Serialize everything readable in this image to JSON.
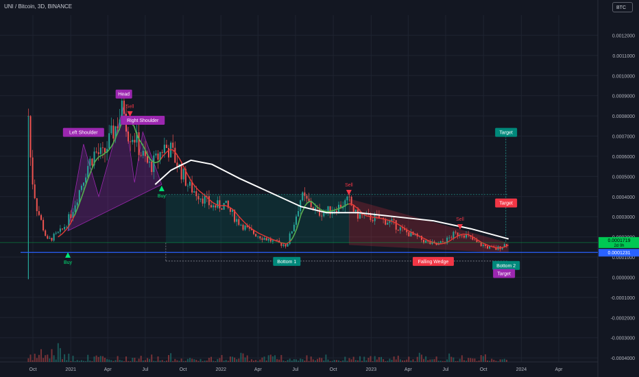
{
  "header": {
    "title": "UNI / Bitcoin, 3D, BINANCE",
    "currency_badge": "BTC"
  },
  "colors": {
    "background": "#131722",
    "grid": "#1f2431",
    "candle_up": "#26a69a",
    "candle_down": "#ef5350",
    "ma_white": "#ffffff",
    "support_line": "#2962ff",
    "last_price": "#00c853",
    "pattern_purple": "#9c27b0",
    "target_teal": "#00897b",
    "target_red": "#f23645"
  },
  "chart_data": {
    "type": "candlestick",
    "title": "UNI / Bitcoin, 3D, BINANCE",
    "y_axis": {
      "ticks": [
        "0.0012000",
        "0.0011000",
        "0.0010000",
        "0.0009000",
        "0.0008000",
        "0.0007000",
        "0.0006000",
        "0.0005000",
        "0.0004000",
        "0.0003000",
        "0.0002000",
        "0.0001000",
        "0.0000000",
        "-0.0001000",
        "-0.0002000",
        "-0.0003000",
        "-0.0004000"
      ],
      "ylim": [
        -0.00042,
        0.0013
      ]
    },
    "x_axis": {
      "ticks": [
        "Oct",
        "2021",
        "Apr",
        "Jul",
        "Oct",
        "2022",
        "Apr",
        "Jul",
        "Oct",
        "2023",
        "Apr",
        "Jul",
        "Oct",
        "2024",
        "Apr"
      ]
    },
    "price_path": [
      [
        "2020-09-20",
        0.0008
      ],
      [
        "2020-09-27",
        0.00052
      ],
      [
        "2020-10-10",
        0.00035
      ],
      [
        "2020-10-25",
        0.00025
      ],
      [
        "2020-11-05",
        0.00018
      ],
      [
        "2020-11-20",
        0.0002
      ],
      [
        "2020-12-10",
        0.00023
      ],
      [
        "2020-12-30",
        0.0003
      ],
      [
        "2021-01-20",
        0.00042
      ],
      [
        "2021-02-10",
        0.00055
      ],
      [
        "2021-03-01",
        0.00062
      ],
      [
        "2021-03-20",
        0.0006
      ],
      [
        "2021-04-10",
        0.0007
      ],
      [
        "2021-05-01",
        0.0008
      ],
      [
        "2021-05-10",
        0.00085
      ],
      [
        "2021-05-20",
        0.00072
      ],
      [
        "2021-06-05",
        0.0007
      ],
      [
        "2021-06-20",
        0.00062
      ],
      [
        "2021-07-10",
        0.00055
      ],
      [
        "2021-07-25",
        0.00057
      ],
      [
        "2021-08-15",
        0.00065
      ],
      [
        "2021-09-01",
        0.00063
      ],
      [
        "2021-09-20",
        0.00055
      ],
      [
        "2021-10-15",
        0.00045
      ],
      [
        "2021-11-15",
        0.0004
      ],
      [
        "2021-12-10",
        0.00035
      ],
      [
        "2022-01-10",
        0.00036
      ],
      [
        "2022-02-10",
        0.00028
      ],
      [
        "2022-03-10",
        0.00023
      ],
      [
        "2022-04-10",
        0.0002
      ],
      [
        "2022-05-15",
        0.00017
      ],
      [
        "2022-06-10",
        0.00016
      ],
      [
        "2022-06-25",
        0.00025
      ],
      [
        "2022-07-15",
        0.0004
      ],
      [
        "2022-08-01",
        0.00037
      ],
      [
        "2022-08-25",
        0.00032
      ],
      [
        "2022-09-20",
        0.00033
      ],
      [
        "2022-10-15",
        0.00035
      ],
      [
        "2022-11-08",
        0.00038
      ],
      [
        "2022-11-25",
        0.00031
      ],
      [
        "2022-12-20",
        0.0003
      ],
      [
        "2023-01-20",
        0.00029
      ],
      [
        "2023-02-20",
        0.00027
      ],
      [
        "2023-03-20",
        0.00023
      ],
      [
        "2023-04-20",
        0.0002
      ],
      [
        "2023-05-20",
        0.00017
      ],
      [
        "2023-06-10",
        0.00016
      ],
      [
        "2023-07-01",
        0.00018
      ],
      [
        "2023-07-20",
        0.00021
      ],
      [
        "2023-08-10",
        0.00022
      ],
      [
        "2023-08-25",
        0.0002
      ],
      [
        "2023-09-15",
        0.00017
      ],
      [
        "2023-10-10",
        0.00015
      ],
      [
        "2023-11-01",
        0.00014
      ],
      [
        "2023-11-20",
        0.00016
      ],
      [
        "2023-12-01",
        0.000172
      ]
    ],
    "last_price": {
      "value": 0.0001719,
      "label": "0.0001719",
      "countdown": "2d 0h"
    },
    "support_level": {
      "value": 0.0001231,
      "label": "0.0001231"
    },
    "resistance_level": 0.00041,
    "entry_level": 0.00017,
    "bottom_level": 8e-05,
    "target_levels": [
      0.00071,
      0.00037,
      0.00012
    ],
    "annotations": [
      {
        "text": "Head",
        "kind": "pattern",
        "date": "2021-05-10",
        "price": 0.00091
      },
      {
        "text": "Left Shoulder",
        "kind": "pattern",
        "date": "2021-02-01",
        "price": 0.00072
      },
      {
        "text": "Right Shoulder",
        "kind": "pattern",
        "date": "2021-06-25",
        "price": 0.00078
      },
      {
        "text": "Buy",
        "kind": "signal",
        "date": "2020-12-25",
        "price": 9e-05
      },
      {
        "text": "Buy",
        "kind": "signal",
        "date": "2021-08-10",
        "price": 0.00042
      },
      {
        "text": "Sell",
        "kind": "signal",
        "date": "2021-05-25",
        "price": 0.00083
      },
      {
        "text": "Sell",
        "kind": "signal",
        "date": "2022-11-08",
        "price": 0.00044
      },
      {
        "text": "Sell",
        "kind": "signal",
        "date": "2023-08-05",
        "price": 0.00027
      },
      {
        "text": "Bottom 1",
        "kind": "pattern",
        "date": "2022-06-10",
        "price": 8e-05
      },
      {
        "text": "Falling Wedge",
        "kind": "pattern",
        "date": "2023-06-01",
        "price": 8e-05
      },
      {
        "text": "Bottom 2",
        "kind": "pattern",
        "date": "2023-11-25",
        "price": 6e-05
      },
      {
        "text": "Target",
        "kind": "target",
        "date": "2023-11-25",
        "price": 0.00037
      },
      {
        "text": "Target",
        "kind": "target",
        "date": "2023-11-25",
        "price": 0.00072
      },
      {
        "text": "Target",
        "kind": "target",
        "date": "2023-11-20",
        "price": 2e-05
      }
    ]
  }
}
